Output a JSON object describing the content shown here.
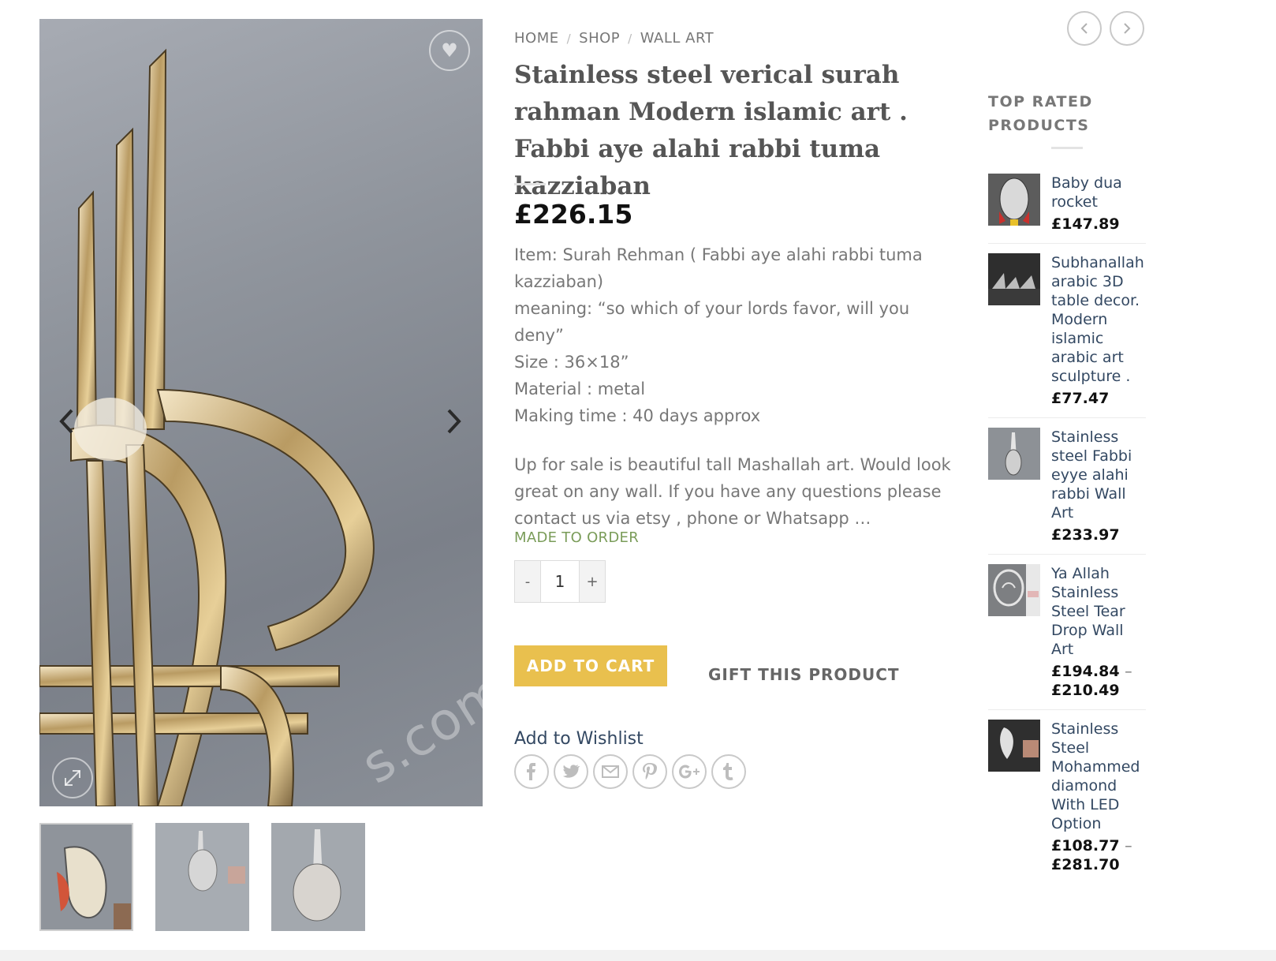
{
  "gallery": {
    "watermark": "s.com",
    "wish_icon": "heart-icon",
    "prev_icon": "chevron-left-icon",
    "next_icon": "chevron-right-icon",
    "zoom_icon": "expand-icon",
    "thumbnails": [
      "thumb-1",
      "thumb-2",
      "thumb-3"
    ]
  },
  "breadcrumb": {
    "home": "HOME",
    "shop": "SHOP",
    "category": "WALL ART",
    "separator": "/"
  },
  "product": {
    "title": "Stainless steel verical surah rahman Modern islamic art . Fabbi aye alahi rabbi tuma kazziaban",
    "price": "£226.15",
    "lines": [
      "Item: Surah Rehman ( Fabbi aye alahi rabbi tuma kazziaban)",
      "meaning: “so which of your lords favor, will you deny”",
      "Size : 36×18”",
      "Material : metal",
      "Making time : 40 days approx"
    ],
    "paragraph": "Up for sale is beautiful tall Mashallah art. Would look great on any wall. If you have any questions please contact us via etsy , phone or Whatsapp …",
    "stock": "MADE TO ORDER",
    "qty_minus": "-",
    "qty_value": "1",
    "qty_plus": "+",
    "add_to_cart": "ADD TO CART",
    "gift": "GIFT THIS PRODUCT",
    "wishlist": "Add to Wishlist",
    "share_icons": [
      "facebook-icon",
      "twitter-icon",
      "email-icon",
      "pinterest-icon",
      "google-plus-icon",
      "tumblr-icon"
    ]
  },
  "sidebar": {
    "heading": "TOP RATED PRODUCTS",
    "items": [
      {
        "name": "Baby dua rocket",
        "price": "£147.89",
        "price_to": ""
      },
      {
        "name": "Subhanallah arabic 3D table decor. Modern islamic arabic art sculpture .",
        "price": "£77.47",
        "price_to": ""
      },
      {
        "name": "Stainless steel Fabbi eyye alahi rabbi Wall Art",
        "price": "£233.97",
        "price_to": ""
      },
      {
        "name": "Ya Allah Stainless Steel Tear Drop Wall Art",
        "price": "£194.84",
        "price_to": "£210.49"
      },
      {
        "name": "Stainless Steel Mohammed diamond With LED Option",
        "price": "£108.77",
        "price_to": "£281.70"
      }
    ]
  },
  "colors": {
    "accent": "#e9c04e",
    "link": "#334862",
    "stock": "#7a9c59",
    "price": "#111111"
  }
}
